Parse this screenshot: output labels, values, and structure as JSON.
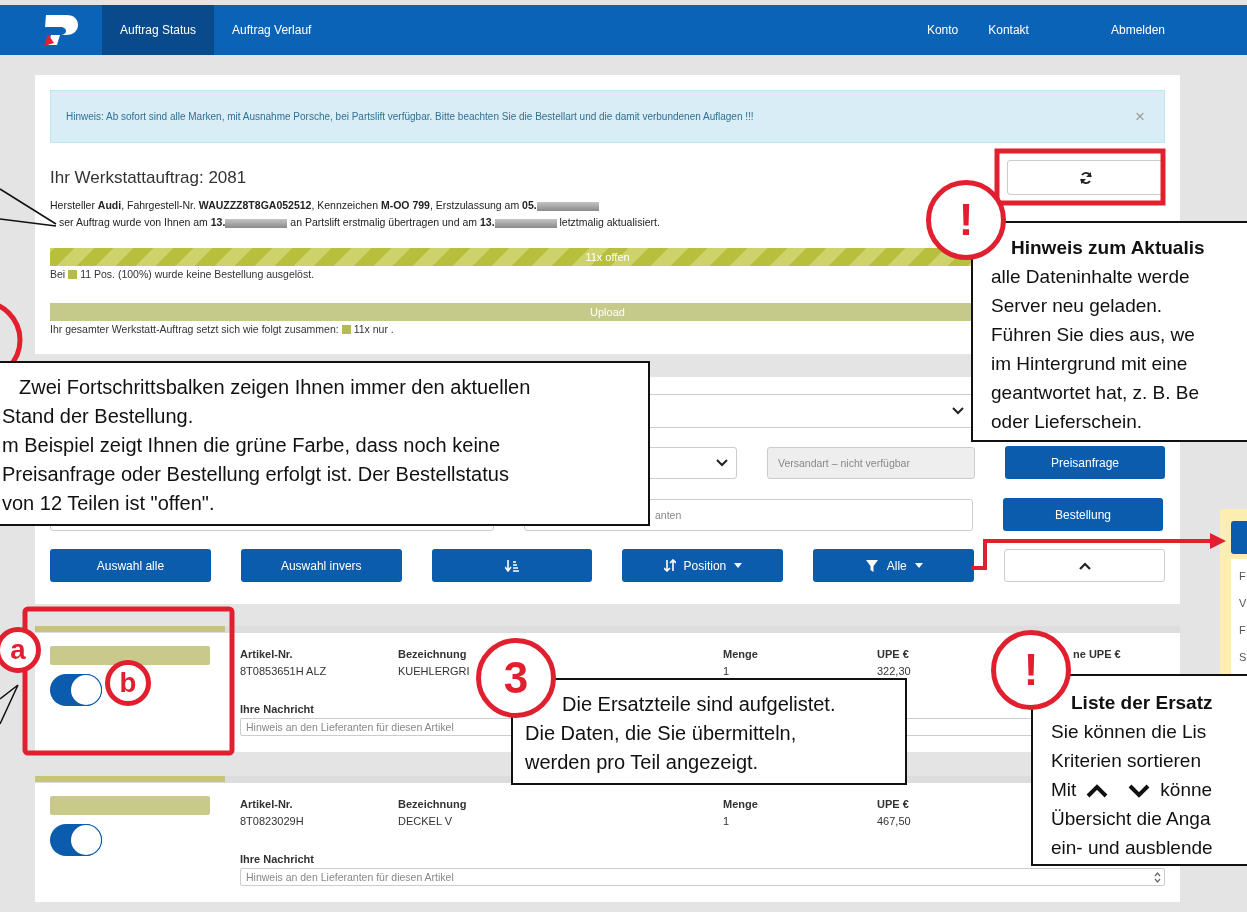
{
  "nav": {
    "tabs": [
      {
        "label": "Auftrag Status",
        "selected": true
      },
      {
        "label": "Auftrag Verlauf",
        "selected": false
      }
    ],
    "links": [
      "Konto",
      "Kontakt",
      "Abmelden"
    ]
  },
  "alert": {
    "text": "Hinweis: Ab sofort sind alle Marken, mit Ausnahme Porsche, bei Partslift verfügbar. Bitte beachten Sie die Bestellart und die damit verbundenen Auflagen !!!",
    "close": "×"
  },
  "order": {
    "title": "Ihr Werkstattauftrag: 2081",
    "info_lines": [
      {
        "segments": [
          {
            "text": "Hersteller **Audi**, Fahrgestell-Nr. **WAUZZZ8T8GA052512**, Kennzeichen **M-OO 799**, Erstzulassung am **05.**",
            "redacted": true
          }
        ]
      },
      {
        "segments": [
          {
            "text": "ser Auftrag wurde von Ihnen am **13.**",
            "redacted": true
          },
          {
            "text": " an Partslift erstmalig übertragen und am **13.**",
            "redacted": true
          },
          {
            "text": " letztmalig aktualisiert.",
            "redacted": false
          }
        ]
      }
    ]
  },
  "progress": [
    {
      "kind": "striped",
      "label": "11x offen",
      "level": 1,
      "legend_before": "Bei",
      "legend_after": "11 Pos. (100%) wurde keine Bestellung ausgelöst."
    },
    {
      "kind": "plain",
      "label": "Upload",
      "level": 1,
      "legend_before": "Ihr gesamter Werkstatt-Auftrag setzt sich wie folgt zusammen:",
      "legend_after": "11x nur ."
    }
  ],
  "form": {
    "shipping_placeholder": "Versandart – nicht verfügbar",
    "message_placeholder": "anten",
    "buttons": [
      "Preisanfrage",
      "Bestellung"
    ]
  },
  "toolbar": {
    "select_all": "Auswahl alle",
    "invert": "Auswahl invers",
    "sort": "Position",
    "filter": "Alle"
  },
  "items": [
    {
      "on": true,
      "artikel_label": "Artikel-Nr.",
      "artikel": "8T0853651H ALZ",
      "bez_label": "Bezeichnung",
      "bez": "KUEHLERGRI",
      "menge_label": "Menge",
      "menge": "1",
      "upe_label": "UPE €",
      "upe": "322,30",
      "col5_label": "ne UPE €",
      "msg_label": "Ihre Nachricht",
      "msg_placeholder": "Hinweis an den Lieferanten für diesen Artikel"
    },
    {
      "on": true,
      "artikel_label": "Artikel-Nr.",
      "artikel": "8T0823029H",
      "bez_label": "Bezeichnung",
      "bez": "DECKEL V",
      "menge_label": "Menge",
      "menge": "1",
      "upe_label": "UPE €",
      "upe": "467,50",
      "msg_label": "Ihre Nachricht",
      "msg_placeholder": "Hinweis an den Lieferanten für diesen Artikel"
    }
  ],
  "side_panel": {
    "items": [
      "F",
      "V",
      "F",
      "S"
    ]
  },
  "callouts": [
    {
      "lines": [
        {
          "kind": "text",
          "text": "Zwei Fortschrittsbalken zeigen Ihnen immer den aktuellen"
        },
        {
          "kind": "text",
          "text": "Stand der Bestellung."
        },
        {
          "kind": "text",
          "text": "m Beispiel zeigt Ihnen die grüne Farbe, dass noch keine"
        },
        {
          "kind": "text",
          "text": "Preisanfrage oder Bestellung  erfolgt ist. Der Bestellstatus"
        },
        {
          "kind": "text",
          "text": "von 12 Teilen ist \"offen\"."
        }
      ]
    },
    {
      "lines": [
        {
          "kind": "heading",
          "text": "Hinweis zum Aktualis"
        },
        {
          "kind": "text",
          "text": "alle Dateninhalte werde"
        },
        {
          "kind": "text",
          "text": "Server neu geladen."
        },
        {
          "kind": "text",
          "text": "Führen Sie dies aus, we"
        },
        {
          "kind": "text",
          "text": "im Hintergrund mit eine"
        },
        {
          "kind": "text",
          "text": "geantwortet hat, z. B. Be"
        },
        {
          "kind": "text",
          "text": "oder Lieferschein."
        }
      ]
    },
    {
      "lines": [
        {
          "kind": "text",
          "text": "Die Ersatzteile sind aufgelistet."
        },
        {
          "kind": "text",
          "text": "Die Daten, die Sie übermitteln,"
        },
        {
          "kind": "text",
          "text": "werden pro Teil angezeigt."
        }
      ]
    },
    {
      "lines": [
        {
          "kind": "heading",
          "text": "Liste der Ersatz"
        },
        {
          "kind": "text",
          "text": "Sie können die Lis"
        },
        {
          "kind": "text",
          "text": "Kriterien sortieren"
        },
        {
          "kind": "icons",
          "before": "Mit",
          "after": "könne"
        },
        {
          "kind": "text",
          "text": "Übersicht die Anga"
        },
        {
          "kind": "text",
          "text": "ein- und ausblende"
        }
      ]
    }
  ],
  "markers": [
    {
      "label": "!"
    },
    {
      "label": "3"
    },
    {
      "label": "!"
    },
    {
      "label": "a"
    },
    {
      "label": "b"
    }
  ]
}
